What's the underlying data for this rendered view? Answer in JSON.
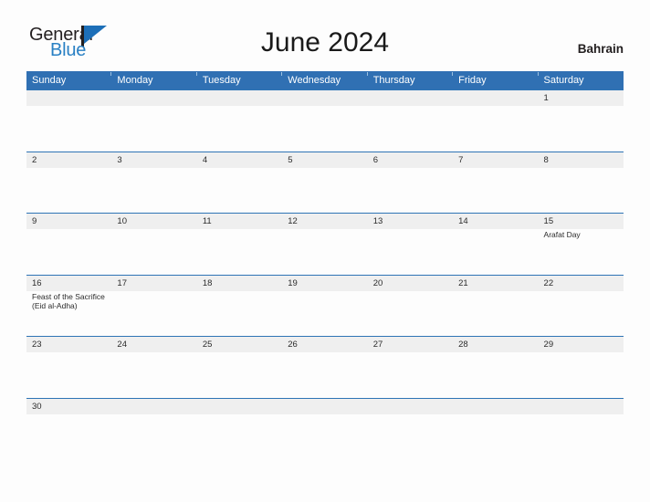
{
  "brand": {
    "word_one": "General",
    "word_two": "Blue",
    "mark_icon": "triangle-flag-icon"
  },
  "header": {
    "title": "June 2024",
    "country": "Bahrain"
  },
  "calendar": {
    "weekdays": [
      "Sunday",
      "Monday",
      "Tuesday",
      "Wednesday",
      "Thursday",
      "Friday",
      "Saturday"
    ],
    "weeks": [
      {
        "days": [
          {
            "date": "",
            "event": ""
          },
          {
            "date": "",
            "event": ""
          },
          {
            "date": "",
            "event": ""
          },
          {
            "date": "",
            "event": ""
          },
          {
            "date": "",
            "event": ""
          },
          {
            "date": "",
            "event": ""
          },
          {
            "date": "1",
            "event": ""
          }
        ]
      },
      {
        "days": [
          {
            "date": "2",
            "event": ""
          },
          {
            "date": "3",
            "event": ""
          },
          {
            "date": "4",
            "event": ""
          },
          {
            "date": "5",
            "event": ""
          },
          {
            "date": "6",
            "event": ""
          },
          {
            "date": "7",
            "event": ""
          },
          {
            "date": "8",
            "event": ""
          }
        ]
      },
      {
        "days": [
          {
            "date": "9",
            "event": ""
          },
          {
            "date": "10",
            "event": ""
          },
          {
            "date": "11",
            "event": ""
          },
          {
            "date": "12",
            "event": ""
          },
          {
            "date": "13",
            "event": ""
          },
          {
            "date": "14",
            "event": ""
          },
          {
            "date": "15",
            "event": "Arafat Day"
          }
        ]
      },
      {
        "days": [
          {
            "date": "16",
            "event": "Feast of the Sacrifice (Eid al-Adha)"
          },
          {
            "date": "17",
            "event": ""
          },
          {
            "date": "18",
            "event": ""
          },
          {
            "date": "19",
            "event": ""
          },
          {
            "date": "20",
            "event": ""
          },
          {
            "date": "21",
            "event": ""
          },
          {
            "date": "22",
            "event": ""
          }
        ]
      },
      {
        "days": [
          {
            "date": "23",
            "event": ""
          },
          {
            "date": "24",
            "event": ""
          },
          {
            "date": "25",
            "event": ""
          },
          {
            "date": "26",
            "event": ""
          },
          {
            "date": "27",
            "event": ""
          },
          {
            "date": "28",
            "event": ""
          },
          {
            "date": "29",
            "event": ""
          }
        ]
      },
      {
        "days": [
          {
            "date": "30",
            "event": ""
          },
          {
            "date": "",
            "event": ""
          },
          {
            "date": "",
            "event": ""
          },
          {
            "date": "",
            "event": ""
          },
          {
            "date": "",
            "event": ""
          },
          {
            "date": "",
            "event": ""
          },
          {
            "date": "",
            "event": ""
          }
        ]
      }
    ]
  },
  "colors": {
    "header_blue": "#3070b3",
    "rule_blue": "#2e74b5",
    "band_gray": "#efefef",
    "brand_blue": "#2980c4",
    "page_bg": "#fdfdfd"
  }
}
